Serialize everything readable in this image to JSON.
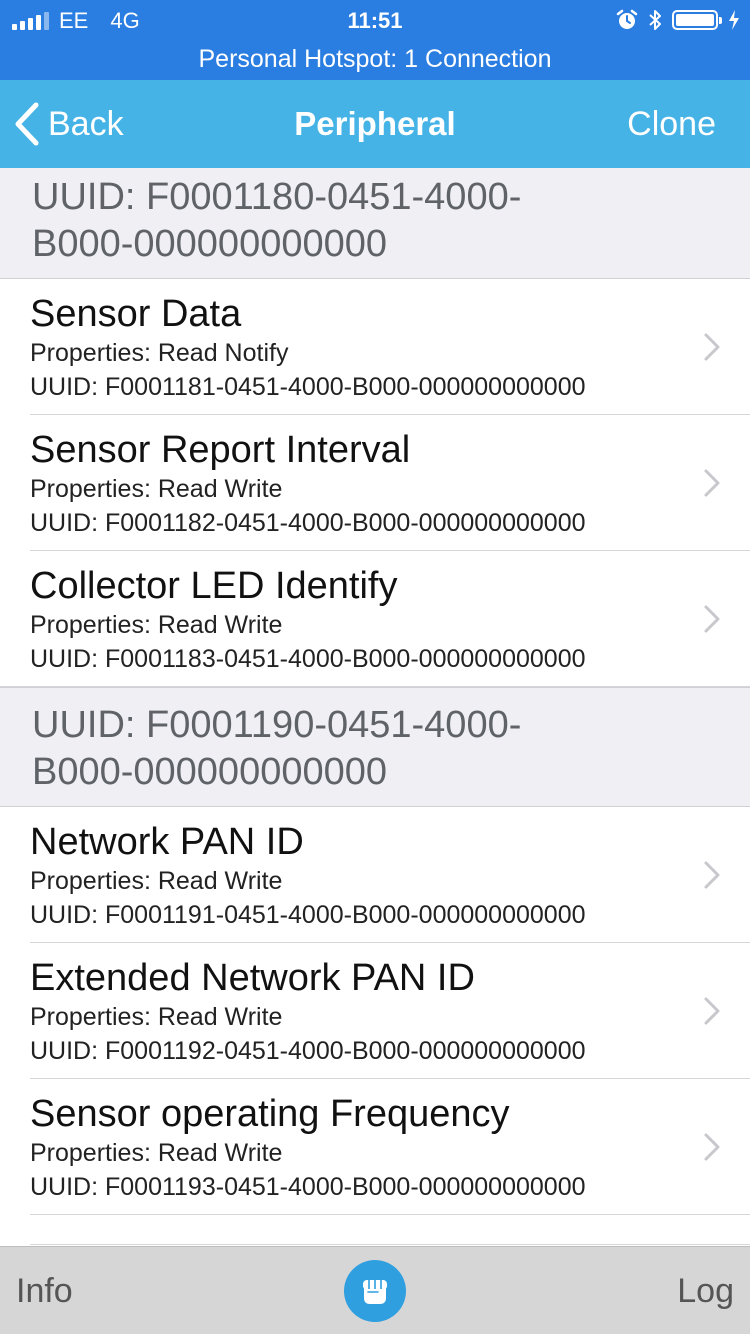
{
  "status_bar": {
    "carrier": "EE",
    "network": "4G",
    "time": "11:51"
  },
  "hotspot_banner": "Personal Hotspot: 1 Connection",
  "navbar": {
    "back_label": "Back",
    "title": "Peripheral",
    "clone_label": "Clone"
  },
  "services": [
    {
      "header": "UUID: F0001180-0451-4000-B000-000000000000",
      "header_line1": "UUID: F0001180-0451-4000-",
      "header_line2": "B000-000000000000",
      "characteristics": [
        {
          "name": "Sensor Data",
          "properties": "Properties: Read Notify",
          "uuid": "UUID: F0001181-0451-4000-B000-000000000000"
        },
        {
          "name": "Sensor Report Interval",
          "properties": "Properties: Read Write",
          "uuid": "UUID: F0001182-0451-4000-B000-000000000000"
        },
        {
          "name": "Collector LED Identify",
          "properties": "Properties: Read Write",
          "uuid": "UUID: F0001183-0451-4000-B000-000000000000"
        }
      ]
    },
    {
      "header": "UUID: F0001190-0451-4000-B000-000000000000",
      "header_line1": "UUID: F0001190-0451-4000-",
      "header_line2": "B000-000000000000",
      "characteristics": [
        {
          "name": "Network PAN ID",
          "properties": "Properties: Read Write",
          "uuid": "UUID: F0001191-0451-4000-B000-000000000000"
        },
        {
          "name": "Extended Network PAN ID",
          "properties": "Properties: Read Write",
          "uuid": "UUID: F0001192-0451-4000-B000-000000000000"
        },
        {
          "name": "Sensor operating Frequency",
          "properties": "Properties: Read Write",
          "uuid": "UUID: F0001193-0451-4000-B000-000000000000"
        }
      ]
    }
  ],
  "tabbar": {
    "info_label": "Info",
    "log_label": "Log",
    "center_icon": "fist-icon"
  },
  "colors": {
    "status_bar": "#2a7de1",
    "navbar": "#46b3e6",
    "section_header_bg": "#efeff4",
    "tabbar_bg": "#d6d6d6",
    "center_button": "#2f9fe0"
  }
}
